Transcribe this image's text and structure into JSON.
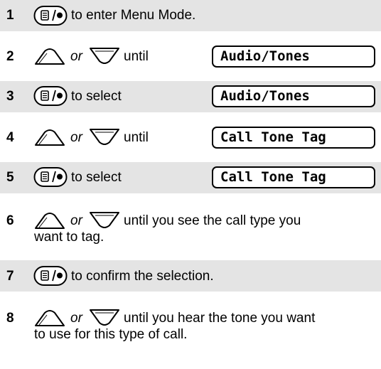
{
  "steps": [
    {
      "number": "1",
      "button": "menu-select-button",
      "text": "to enter Menu Mode."
    },
    {
      "number": "2",
      "nav": "up-down-scroll",
      "or": "or",
      "text": "until",
      "display": "Audio/Tones"
    },
    {
      "number": "3",
      "button": "menu-select-button",
      "text": "to select",
      "display": "Audio/Tones"
    },
    {
      "number": "4",
      "nav": "up-down-scroll",
      "or": "or",
      "text": "until",
      "display": "Call Tone Tag"
    },
    {
      "number": "5",
      "button": "menu-select-button",
      "text": "to select",
      "display": "Call Tone Tag"
    },
    {
      "number": "6",
      "nav": "up-down-scroll",
      "or": "or",
      "text_line1": "until you see the call type you",
      "text_line2": "want to tag."
    },
    {
      "number": "7",
      "button": "menu-select-button",
      "text": "to confirm the selection."
    },
    {
      "number": "8",
      "nav": "up-down-scroll",
      "or": "or",
      "text_line1": "until you hear the tone you want",
      "text_line2": "to use for this type of call."
    }
  ],
  "colors": {
    "shade": "#e4e4e4",
    "text": "#000000"
  }
}
